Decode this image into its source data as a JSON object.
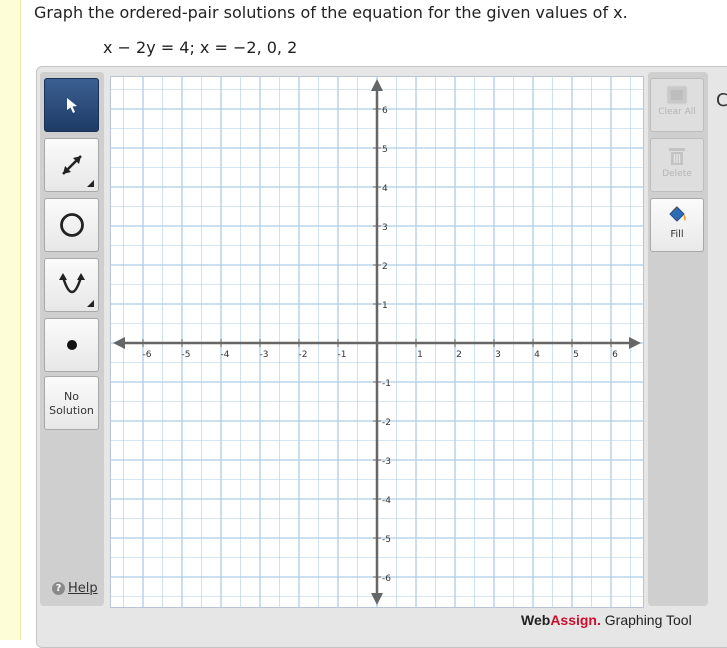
{
  "question": {
    "prompt": "Graph the ordered-pair solutions of the equation for the given values of x.",
    "equation": "x − 2y = 4; x = −2, 0, 2"
  },
  "toolbar": {
    "tools": [
      {
        "name": "pointer",
        "icon": "cursor-arrow-icon",
        "active": true
      },
      {
        "name": "line",
        "icon": "double-arrow-line-icon",
        "active": false
      },
      {
        "name": "circle",
        "icon": "circle-icon",
        "active": false
      },
      {
        "name": "parabola",
        "icon": "parabola-icon",
        "active": false
      },
      {
        "name": "point",
        "icon": "point-icon",
        "active": false
      }
    ],
    "no_solution_line1": "No",
    "no_solution_line2": "Solution",
    "help_label": "Help"
  },
  "right_panel": {
    "clear_all_label": "Clear All",
    "delete_label": "Delete",
    "fill_label": "Fill"
  },
  "graph": {
    "x_range": [
      -6,
      6
    ],
    "y_range": [
      -6,
      6
    ],
    "x_ticks": [
      "-6",
      "-5",
      "-4",
      "-3",
      "-2",
      "-1",
      "1",
      "2",
      "3",
      "4",
      "5",
      "6"
    ],
    "y_ticks": [
      "6",
      "5",
      "4",
      "3",
      "2",
      "1",
      "-1",
      "-2",
      "-3",
      "-4",
      "-5",
      "-6"
    ],
    "grid_color": "#aecde6",
    "axis_color": "#666666"
  },
  "branding": {
    "web": "Web",
    "assign": "Assign.",
    "rest": " Graphing Tool",
    "accent_color": "#c8102e"
  },
  "cut_off_text": "C"
}
